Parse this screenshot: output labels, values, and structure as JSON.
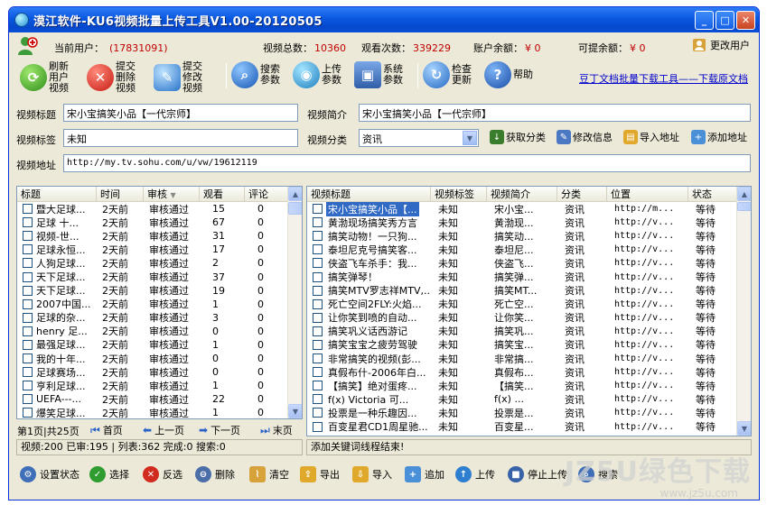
{
  "window": {
    "title": "漠江软件-KU6视频批量上传工具V1.00-20120505"
  },
  "stats": {
    "user_label": "当前用户：",
    "user_value": "(17831091)",
    "videos_label": "视频总数：",
    "videos_value": "10360",
    "views_label": "观看次数：",
    "views_value": "339229",
    "balance_label": "账户余额：",
    "balance_value": "¥ 0",
    "withdraw_label": "可提余额：",
    "withdraw_value": "¥ 0",
    "change_user": "更改用户"
  },
  "toolbar": {
    "refresh": "刷新用户视频",
    "delete_submit": "提交删除视频",
    "modify_submit": "提交修改视频",
    "search_params": "搜索参数",
    "upload_params": "上传参数",
    "system_params": "系统参数",
    "check_update": "检查更新",
    "help": "帮助",
    "link": "豆丁文档批量下载工具——下载原文档"
  },
  "form": {
    "title_label": "视频标题",
    "title_value": "宋小宝搞笑小品【一代宗师】",
    "desc_label": "视频简介",
    "desc_value": "宋小宝搞笑小品【一代宗师】",
    "tag_label": "视频标签",
    "tag_value": "未知",
    "cat_label": "视频分类",
    "cat_value": "资讯",
    "url_label": "视频地址",
    "url_value": "http://my.tv.sohu.com/u/vw/19612119",
    "get_category": "获取分类",
    "modify_info": "修改信息",
    "import_url": "导入地址",
    "add_url": "添加地址"
  },
  "left_table": {
    "headers": [
      "标题",
      "时间",
      "审核",
      "观看",
      "评论"
    ],
    "rows": [
      [
        "暨大足球...",
        "2天前",
        "审核通过",
        "15",
        "0"
      ],
      [
        "足球 十...",
        "2天前",
        "审核通过",
        "67",
        "0"
      ],
      [
        "视频-世...",
        "2天前",
        "审核通过",
        "31",
        "0"
      ],
      [
        "足球永恒...",
        "2天前",
        "审核通过",
        "17",
        "0"
      ],
      [
        "人狗足球...",
        "2天前",
        "审核通过",
        "2",
        "0"
      ],
      [
        "天下足球...",
        "2天前",
        "审核通过",
        "37",
        "0"
      ],
      [
        "天下足球...",
        "2天前",
        "审核通过",
        "19",
        "0"
      ],
      [
        "2007中国...",
        "2天前",
        "审核通过",
        "1",
        "0"
      ],
      [
        "足球的杂...",
        "2天前",
        "审核通过",
        "3",
        "0"
      ],
      [
        "henry 足...",
        "2天前",
        "审核通过",
        "0",
        "0"
      ],
      [
        "最强足球...",
        "2天前",
        "审核通过",
        "1",
        "0"
      ],
      [
        "我的十年...",
        "2天前",
        "审核通过",
        "0",
        "0"
      ],
      [
        "足球赛场...",
        "2天前",
        "审核通过",
        "0",
        "0"
      ],
      [
        "亨利足球...",
        "2天前",
        "审核通过",
        "1",
        "0"
      ],
      [
        "UEFA---...",
        "2天前",
        "审核通过",
        "22",
        "0"
      ],
      [
        "爆笑足球...",
        "2天前",
        "审核通过",
        "1",
        "0"
      ]
    ]
  },
  "pager": {
    "info": "第1页|共25页",
    "first": "首页",
    "prev": "上一页",
    "next": "下一页",
    "last": "末页"
  },
  "right_table": {
    "headers": [
      "视频标题",
      "视频标签",
      "视频简介",
      "分类",
      "位置",
      "状态"
    ],
    "rows": [
      [
        "宋小宝搞笑小品【...",
        "未知",
        "宋小宝...",
        "资讯",
        "http://m...",
        "等待"
      ],
      [
        "黄渤现场搞笑秀方言",
        "未知",
        "黄渤现...",
        "资讯",
        "http://v...",
        "等待"
      ],
      [
        "搞笑动物！一只狗...",
        "未知",
        "搞笑动...",
        "资讯",
        "http://v...",
        "等待"
      ],
      [
        "泰坦尼克号搞笑客...",
        "未知",
        "泰坦尼...",
        "资讯",
        "http://v...",
        "等待"
      ],
      [
        "侠盗飞车杀手：我...",
        "未知",
        "侠盗飞...",
        "资讯",
        "http://v...",
        "等待"
      ],
      [
        "搞笑弹琴！",
        "未知",
        "搞笑弹...",
        "资讯",
        "http://v...",
        "等待"
      ],
      [
        "搞笑MTV罗志祥MTV,...",
        "未知",
        "搞笑MT...",
        "资讯",
        "http://v...",
        "等待"
      ],
      [
        "死亡空间2FLY:火焰...",
        "未知",
        "死亡空...",
        "资讯",
        "http://v...",
        "等待"
      ],
      [
        "让你笑到喷的自动...",
        "未知",
        "让你笑...",
        "资讯",
        "http://v...",
        "等待"
      ],
      [
        "搞笑巩义话西游记",
        "未知",
        "搞笑巩...",
        "资讯",
        "http://v...",
        "等待"
      ],
      [
        "搞笑宝宝之疲劳驾驶",
        "未知",
        "搞笑宝...",
        "资讯",
        "http://v...",
        "等待"
      ],
      [
        "非常搞笑的视频(彭...",
        "未知",
        "非常搞...",
        "资讯",
        "http://v...",
        "等待"
      ],
      [
        "真假布什-2006年白...",
        "未知",
        "真假布...",
        "资讯",
        "http://v...",
        "等待"
      ],
      [
        "【搞笑】绝对蛋疼...",
        "未知",
        "【搞笑...",
        "资讯",
        "http://v...",
        "等待"
      ],
      [
        "f(x) Victoria 可...",
        "未知",
        "f(x) ...",
        "资讯",
        "http://v...",
        "等待"
      ],
      [
        "投票是一种乐趣因...",
        "未知",
        "投票是...",
        "资讯",
        "http://v...",
        "等待"
      ],
      [
        "百变星君CD1周星驰...",
        "未知",
        "百变星...",
        "资讯",
        "http://v...",
        "等待"
      ]
    ]
  },
  "statusbar": {
    "left": "视频:200 已审:195 | 列表:362 完成:0 搜索:0",
    "right": "添加关键词线程结束!"
  },
  "bottom": {
    "settings": "设置状态",
    "select": "选择",
    "invert": "反选",
    "delete": "删除",
    "clear": "清空",
    "export": "导出",
    "import": "导入",
    "append": "追加",
    "upload": "上传",
    "stop_upload": "停止上传",
    "search": "搜索"
  },
  "watermark": {
    "big": "JZ5U绿色下载",
    "small": "www.jz5u.com"
  },
  "colors": {
    "title_bar": "#0A58E0",
    "window_bg": "#ECE9D8",
    "stat_value": "#C00000",
    "link": "#0000CC",
    "selection": "#316AC5"
  }
}
